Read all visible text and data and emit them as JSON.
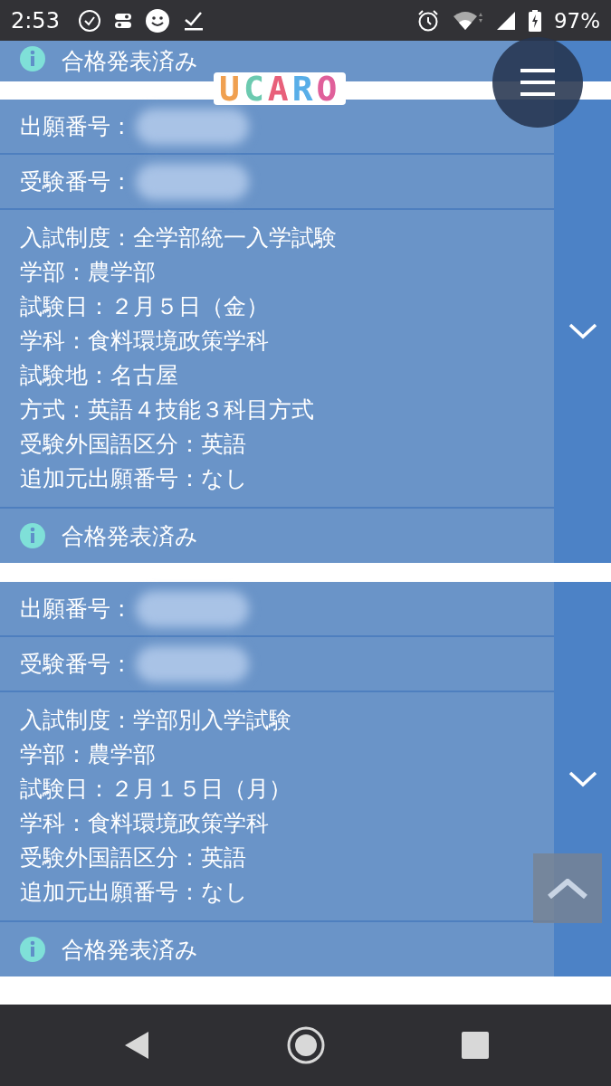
{
  "status_bar": {
    "time": "2:53",
    "battery": "97%"
  },
  "logo": "UCARO",
  "top_card": {
    "status": "合格発表済み"
  },
  "cards": [
    {
      "fields": [
        {
          "label": "出願番号 :"
        },
        {
          "label": "受験番号 :"
        }
      ],
      "details": [
        "入試制度：全学部統一入学試験",
        "学部：農学部",
        "試験日：２月５日（金）",
        "学科：食料環境政策学科",
        "試験地：名古屋",
        "方式：英語４技能３科目方式",
        "受験外国語区分：英語",
        "追加元出願番号：なし"
      ],
      "status": "合格発表済み"
    },
    {
      "fields": [
        {
          "label": "出願番号 :"
        },
        {
          "label": "受験番号 :"
        }
      ],
      "details": [
        "入試制度：学部別入学試験",
        "学部：農学部",
        "試験日：２月１５日（月）",
        "学科：食料環境政策学科",
        "受験外国語区分：英語",
        "追加元出願番号：なし"
      ],
      "status": "合格発表済み"
    }
  ]
}
